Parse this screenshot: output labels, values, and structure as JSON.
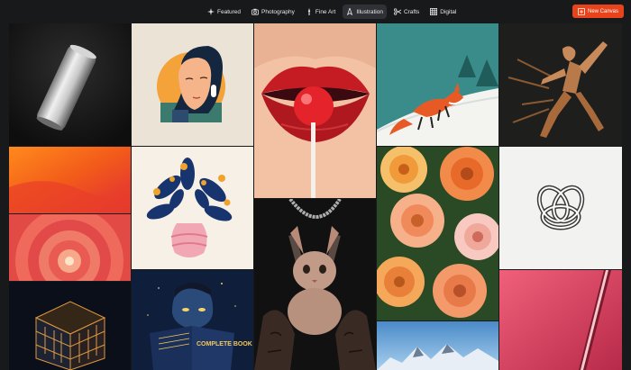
{
  "nav": {
    "items": [
      {
        "label": "Featured",
        "icon": "sparkle-icon"
      },
      {
        "label": "Photography",
        "icon": "camera-icon"
      },
      {
        "label": "Fine Art",
        "icon": "brush-icon"
      },
      {
        "label": "Illustration",
        "icon": "pen-icon"
      },
      {
        "label": "Crafts",
        "icon": "scissors-icon"
      },
      {
        "label": "Digital",
        "icon": "grid-icon"
      }
    ],
    "active": "Illustration"
  },
  "actions": {
    "new_canvas_label": "New Canvas"
  },
  "colors": {
    "accent": "#e8431a",
    "background": "#17191b",
    "active_tab": "#2e3135"
  },
  "gallery": {
    "tiles": [
      {
        "name": "aluminum-can"
      },
      {
        "name": "woman-portrait-illustration"
      },
      {
        "name": "lips-lollipop"
      },
      {
        "name": "fox-snow"
      },
      {
        "name": "dancer-motion"
      },
      {
        "name": "orange-gradient"
      },
      {
        "name": "vase-plant-illustration"
      },
      {
        "name": "flowers-dahlias"
      },
      {
        "name": "knot-3d"
      },
      {
        "name": "pink-tunnel"
      },
      {
        "name": "sphynx-cat-hands"
      },
      {
        "name": "glass-cube"
      },
      {
        "name": "book-reader-illustration"
      },
      {
        "name": "mountains"
      },
      {
        "name": "pink-stick"
      }
    ],
    "book_text": "COMPLETE BOOK"
  }
}
